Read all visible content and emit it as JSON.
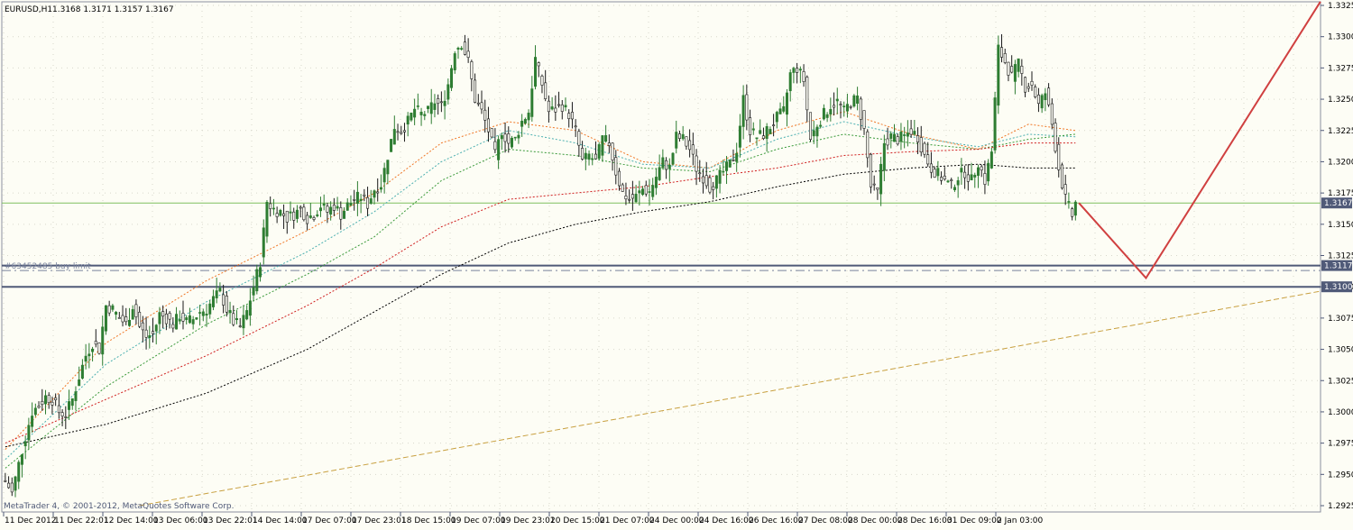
{
  "chart_header": {
    "symbol": "EURUSD,H1",
    "ohlc": "1.3168 1.3171 1.3157 1.3167"
  },
  "footer_text": "MetaTrader 4, © 2001-2012, MetaQuotes Software Corp.",
  "order_label": "#63452485 buy limit",
  "colors": {
    "background": "#fdfdf5",
    "bull_candle": "#2e7d32",
    "bear_candle": "#1a1a1a",
    "ma_orange": "#f07828",
    "ma_cyan": "#4cb0b0",
    "ma_green": "#3a9a3a",
    "ma_red": "#d02020",
    "ma_black": "#000000",
    "current_price_line": "#7fbf5f",
    "level_line": "#505a78",
    "trend_line": "#c8a040",
    "projection": "#d04040"
  },
  "chart_data": {
    "type": "candlestick",
    "symbol": "EURUSD",
    "timeframe": "H1",
    "ylim": [
      1.2925,
      1.3325
    ],
    "y_ticks": [
      "1.3325",
      "1.3300",
      "1.3275",
      "1.3250",
      "1.3225",
      "1.3200",
      "1.3175",
      "1.3150",
      "1.3125",
      "1.3100",
      "1.3075",
      "1.3050",
      "1.3025",
      "1.3000",
      "1.2975",
      "1.2950",
      "1.2925"
    ],
    "x_ticks": [
      "11 Dec 2012",
      "11 Dec 22:01",
      "12 Dec 14:00",
      "13 Dec 06:00",
      "13 Dec 22:01",
      "14 Dec 14:00",
      "17 Dec 07:00",
      "17 Dec 23:01",
      "18 Dec 15:00",
      "19 Dec 07:00",
      "19 Dec 23:01",
      "20 Dec 15:00",
      "21 Dec 07:00",
      "24 Dec 00:00",
      "24 Dec 16:00",
      "26 Dec 16:00",
      "27 Dec 08:00",
      "28 Dec 00:00",
      "28 Dec 16:00",
      "31 Dec 09:00",
      "2 Jan 03:00"
    ],
    "price_labels": {
      "current": "1.3167",
      "buy_limit": "1.3117",
      "support": "1.3100"
    },
    "levels": {
      "current": 1.3167,
      "buy_limit": 1.3113,
      "support_upper": 1.3117,
      "support_lower": 1.31
    },
    "price_path": [
      [
        0,
        1.2945
      ],
      [
        2,
        1.2935
      ],
      [
        4,
        1.2958
      ],
      [
        6,
        1.298
      ],
      [
        8,
        1.3
      ],
      [
        10,
        1.3005
      ],
      [
        12,
        1.3012
      ],
      [
        14,
        1.301
      ],
      [
        16,
        1.3
      ],
      [
        18,
        1.2998
      ],
      [
        20,
        1.301
      ],
      [
        22,
        1.3028
      ],
      [
        24,
        1.3045
      ],
      [
        26,
        1.3055
      ],
      [
        28,
        1.305
      ],
      [
        30,
        1.3085
      ],
      [
        32,
        1.3082
      ],
      [
        34,
        1.3075
      ],
      [
        36,
        1.307
      ],
      [
        38,
        1.3085
      ],
      [
        40,
        1.3068
      ],
      [
        42,
        1.306
      ],
      [
        44,
        1.3062
      ],
      [
        46,
        1.3078
      ],
      [
        48,
        1.3075
      ],
      [
        50,
        1.307
      ],
      [
        52,
        1.3077
      ],
      [
        54,
        1.3072
      ],
      [
        56,
        1.3074
      ],
      [
        58,
        1.308
      ],
      [
        60,
        1.3082
      ],
      [
        62,
        1.309
      ],
      [
        64,
        1.3096
      ],
      [
        66,
        1.3082
      ],
      [
        68,
        1.3072
      ],
      [
        70,
        1.3068
      ],
      [
        72,
        1.308
      ],
      [
        74,
        1.31
      ],
      [
        76,
        1.312
      ],
      [
        78,
        1.3168
      ],
      [
        80,
        1.3162
      ],
      [
        82,
        1.316
      ],
      [
        84,
        1.3155
      ],
      [
        86,
        1.3158
      ],
      [
        88,
        1.3162
      ],
      [
        90,
        1.3155
      ],
      [
        92,
        1.3158
      ],
      [
        94,
        1.3165
      ],
      [
        96,
        1.316
      ],
      [
        98,
        1.3165
      ],
      [
        100,
        1.3158
      ],
      [
        102,
        1.3165
      ],
      [
        104,
        1.317
      ],
      [
        106,
        1.3172
      ],
      [
        108,
        1.3166
      ],
      [
        110,
        1.3178
      ],
      [
        112,
        1.3182
      ],
      [
        114,
        1.3205
      ],
      [
        116,
        1.3228
      ],
      [
        118,
        1.3225
      ],
      [
        120,
        1.3232
      ],
      [
        122,
        1.3242
      ],
      [
        124,
        1.3238
      ],
      [
        126,
        1.324
      ],
      [
        128,
        1.3248
      ],
      [
        130,
        1.3244
      ],
      [
        132,
        1.3262
      ],
      [
        134,
        1.329
      ],
      [
        136,
        1.3295
      ],
      [
        138,
        1.328
      ],
      [
        140,
        1.325
      ],
      [
        142,
        1.324
      ],
      [
        144,
        1.3225
      ],
      [
        146,
        1.3205
      ],
      [
        148,
        1.3225
      ],
      [
        150,
        1.3215
      ],
      [
        152,
        1.3218
      ],
      [
        154,
        1.3232
      ],
      [
        156,
        1.324
      ],
      [
        158,
        1.3282
      ],
      [
        160,
        1.3262
      ],
      [
        162,
        1.324
      ],
      [
        164,
        1.3242
      ],
      [
        166,
        1.3245
      ],
      [
        168,
        1.3238
      ],
      [
        170,
        1.3225
      ],
      [
        172,
        1.32
      ],
      [
        174,
        1.3205
      ],
      [
        176,
        1.32
      ],
      [
        178,
        1.3218
      ],
      [
        180,
        1.3215
      ],
      [
        182,
        1.3192
      ],
      [
        184,
        1.3175
      ],
      [
        186,
        1.317
      ],
      [
        188,
        1.3172
      ],
      [
        190,
        1.3178
      ],
      [
        192,
        1.3176
      ],
      [
        194,
        1.3188
      ],
      [
        196,
        1.32
      ],
      [
        198,
        1.3195
      ],
      [
        200,
        1.322
      ],
      [
        202,
        1.3218
      ],
      [
        204,
        1.321
      ],
      [
        206,
        1.3195
      ],
      [
        208,
        1.3188
      ],
      [
        210,
        1.318
      ],
      [
        212,
        1.3185
      ],
      [
        214,
        1.3192
      ],
      [
        216,
        1.3198
      ],
      [
        218,
        1.321
      ],
      [
        220,
        1.325
      ],
      [
        222,
        1.3225
      ],
      [
        224,
        1.322
      ],
      [
        226,
        1.3222
      ],
      [
        228,
        1.3228
      ],
      [
        230,
        1.3235
      ],
      [
        232,
        1.324
      ],
      [
        234,
        1.327
      ],
      [
        236,
        1.3275
      ],
      [
        238,
        1.3265
      ],
      [
        240,
        1.3218
      ],
      [
        242,
        1.323
      ],
      [
        244,
        1.3238
      ],
      [
        246,
        1.3245
      ],
      [
        248,
        1.3248
      ],
      [
        250,
        1.324
      ],
      [
        252,
        1.3248
      ],
      [
        254,
        1.325
      ],
      [
        256,
        1.3225
      ],
      [
        258,
        1.318
      ],
      [
        260,
        1.3175
      ],
      [
        262,
        1.3215
      ],
      [
        264,
        1.322
      ],
      [
        266,
        1.3218
      ],
      [
        268,
        1.322
      ],
      [
        270,
        1.3225
      ],
      [
        272,
        1.322
      ],
      [
        274,
        1.3205
      ],
      [
        276,
        1.3195
      ],
      [
        278,
        1.319
      ],
      [
        280,
        1.3185
      ],
      [
        282,
        1.318
      ],
      [
        284,
        1.3188
      ],
      [
        286,
        1.3192
      ],
      [
        288,
        1.3185
      ],
      [
        290,
        1.32
      ],
      [
        292,
        1.3185
      ],
      [
        294,
        1.3208
      ],
      [
        296,
        1.329
      ],
      [
        298,
        1.328
      ],
      [
        300,
        1.3268
      ],
      [
        302,
        1.3278
      ],
      [
        304,
        1.326
      ],
      [
        306,
        1.3262
      ],
      [
        308,
        1.3245
      ],
      [
        310,
        1.3255
      ],
      [
        312,
        1.323
      ],
      [
        314,
        1.3195
      ],
      [
        316,
        1.317
      ],
      [
        318,
        1.3157
      ],
      [
        319,
        1.3167
      ]
    ],
    "moving_averages": [
      {
        "color_key": "ma_orange",
        "points": [
          [
            0,
            1.297
          ],
          [
            30,
            1.3055
          ],
          [
            60,
            1.3105
          ],
          [
            90,
            1.3145
          ],
          [
            110,
            1.3175
          ],
          [
            130,
            1.3215
          ],
          [
            150,
            1.3232
          ],
          [
            170,
            1.3225
          ],
          [
            190,
            1.32
          ],
          [
            210,
            1.3195
          ],
          [
            230,
            1.3225
          ],
          [
            250,
            1.324
          ],
          [
            270,
            1.3222
          ],
          [
            290,
            1.321
          ],
          [
            305,
            1.323
          ],
          [
            319,
            1.3225
          ]
        ]
      },
      {
        "color_key": "ma_cyan",
        "points": [
          [
            0,
            1.2962
          ],
          [
            30,
            1.3038
          ],
          [
            60,
            1.3088
          ],
          [
            90,
            1.3128
          ],
          [
            110,
            1.316
          ],
          [
            130,
            1.32
          ],
          [
            150,
            1.3225
          ],
          [
            170,
            1.3215
          ],
          [
            190,
            1.3198
          ],
          [
            210,
            1.3195
          ],
          [
            230,
            1.3218
          ],
          [
            250,
            1.3232
          ],
          [
            270,
            1.322
          ],
          [
            290,
            1.3212
          ],
          [
            305,
            1.3222
          ],
          [
            319,
            1.322
          ]
        ]
      },
      {
        "color_key": "ma_green",
        "points": [
          [
            0,
            1.2955
          ],
          [
            30,
            1.302
          ],
          [
            60,
            1.307
          ],
          [
            90,
            1.311
          ],
          [
            110,
            1.314
          ],
          [
            130,
            1.3185
          ],
          [
            150,
            1.321
          ],
          [
            170,
            1.3205
          ],
          [
            190,
            1.3195
          ],
          [
            210,
            1.3192
          ],
          [
            230,
            1.321
          ],
          [
            250,
            1.3222
          ],
          [
            270,
            1.3215
          ],
          [
            290,
            1.321
          ],
          [
            305,
            1.3218
          ],
          [
            319,
            1.3222
          ]
        ]
      },
      {
        "color_key": "ma_red",
        "points": [
          [
            0,
            1.2975
          ],
          [
            30,
            1.301
          ],
          [
            60,
            1.3045
          ],
          [
            90,
            1.3085
          ],
          [
            110,
            1.3115
          ],
          [
            130,
            1.3148
          ],
          [
            150,
            1.317
          ],
          [
            170,
            1.3175
          ],
          [
            190,
            1.318
          ],
          [
            210,
            1.3188
          ],
          [
            230,
            1.3195
          ],
          [
            250,
            1.3205
          ],
          [
            270,
            1.3208
          ],
          [
            290,
            1.321
          ],
          [
            305,
            1.3215
          ],
          [
            319,
            1.3215
          ]
        ]
      },
      {
        "color_key": "ma_black",
        "points": [
          [
            0,
            1.2972
          ],
          [
            30,
            1.299
          ],
          [
            60,
            1.3015
          ],
          [
            90,
            1.305
          ],
          [
            110,
            1.308
          ],
          [
            130,
            1.311
          ],
          [
            150,
            1.3135
          ],
          [
            170,
            1.315
          ],
          [
            190,
            1.316
          ],
          [
            210,
            1.3168
          ],
          [
            230,
            1.318
          ],
          [
            250,
            1.319
          ],
          [
            270,
            1.3195
          ],
          [
            290,
            1.3198
          ],
          [
            305,
            1.3195
          ],
          [
            319,
            1.3195
          ]
        ]
      }
    ],
    "trend_line": [
      [
        40,
        1.2925
      ],
      [
        430,
        1.3115
      ]
    ],
    "projection": [
      [
        320,
        1.3167
      ],
      [
        340,
        1.3107
      ],
      [
        392,
        1.3328
      ]
    ]
  }
}
